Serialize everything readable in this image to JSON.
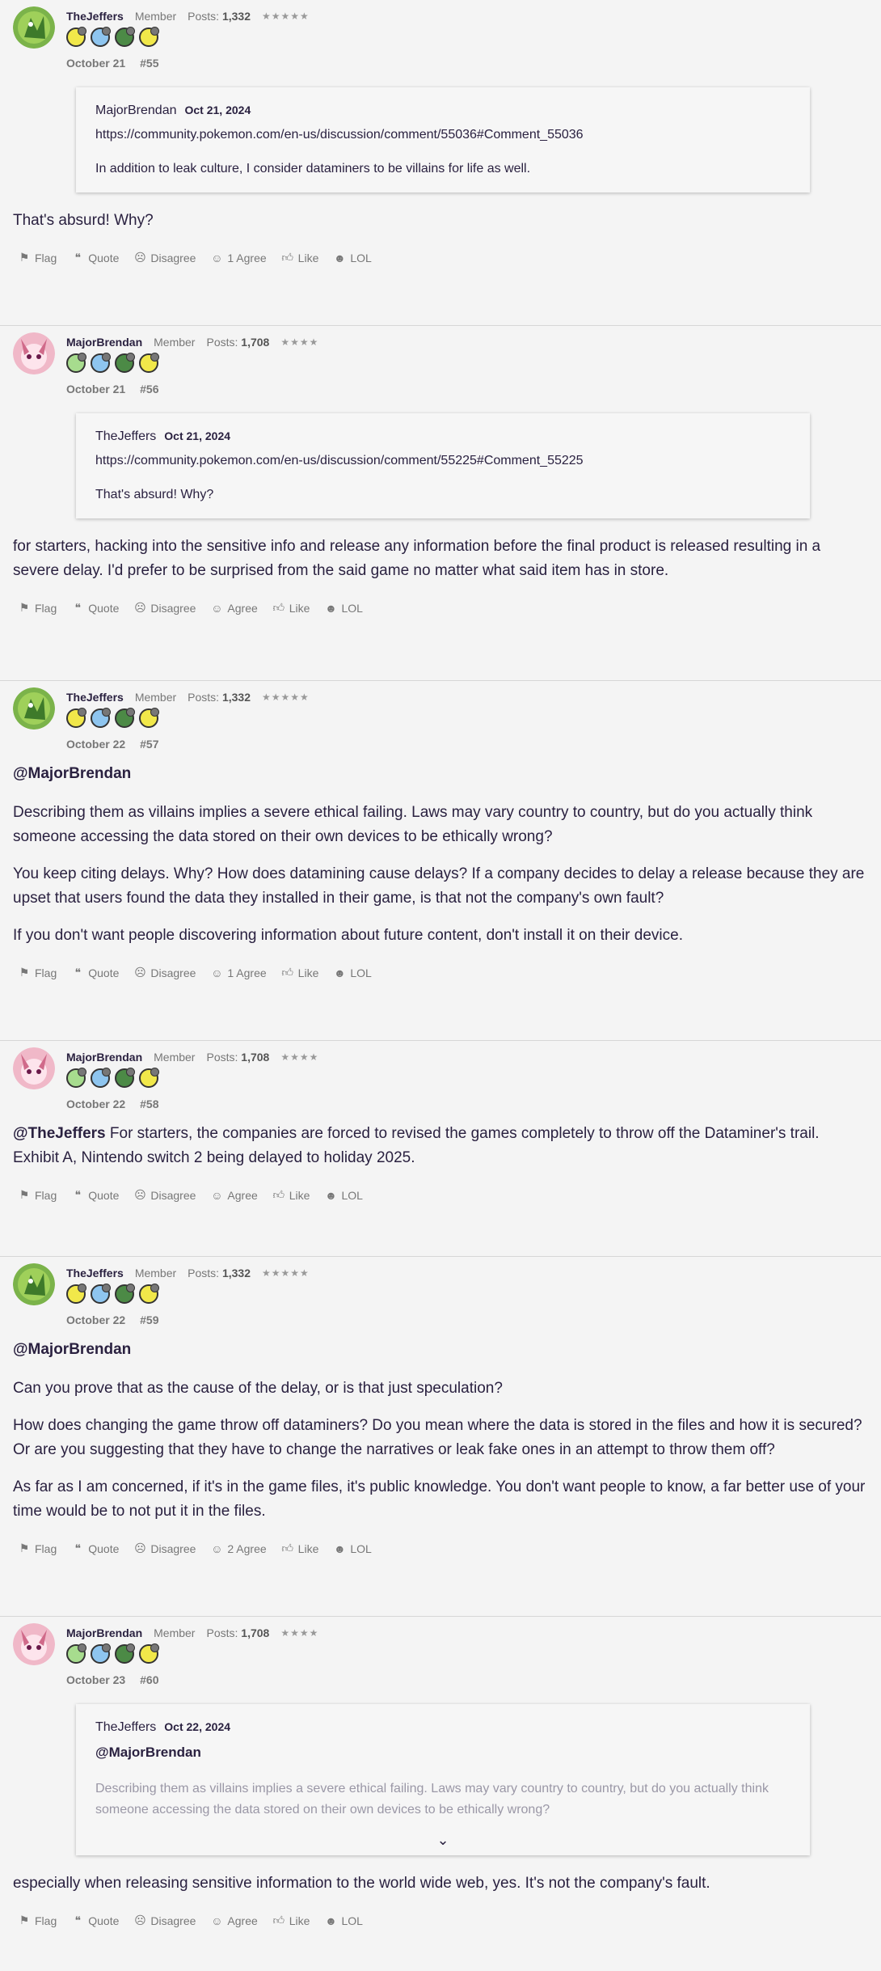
{
  "posts": [
    {
      "author": "TheJeffers",
      "role": "Member",
      "posts_label": "Posts:",
      "posts_count": "1,332",
      "stars": "★★★★★",
      "date": "October 21",
      "number": "#55",
      "quote": {
        "author": "MajorBrendan",
        "date": "Oct 21, 2024",
        "link": "https://community.pokemon.com/en-us/discussion/comment/55036#Comment_55036",
        "text": "In addition to leak culture, I consider dataminers to be villains for life as well."
      },
      "paragraphs": [
        "That's absurd! Why?"
      ],
      "actions": {
        "flag": "Flag",
        "quote": "Quote",
        "disagree": "Disagree",
        "agree": "1 Agree",
        "like": "Like",
        "lol": "LOL"
      }
    },
    {
      "author": "MajorBrendan",
      "role": "Member",
      "posts_label": "Posts:",
      "posts_count": "1,708",
      "stars": "★★★★",
      "date": "October 21",
      "number": "#56",
      "quote": {
        "author": "TheJeffers",
        "date": "Oct 21, 2024",
        "link": "https://community.pokemon.com/en-us/discussion/comment/55225#Comment_55225",
        "text": "That's absurd! Why?"
      },
      "paragraphs": [
        "for starters, hacking into the sensitive info and release any information before the final product is released resulting in a severe delay. I'd prefer to be surprised from the said game no matter what said item has in store."
      ],
      "actions": {
        "flag": "Flag",
        "quote": "Quote",
        "disagree": "Disagree",
        "agree": "Agree",
        "like": "Like",
        "lol": "LOL"
      }
    },
    {
      "author": "TheJeffers",
      "role": "Member",
      "posts_label": "Posts:",
      "posts_count": "1,332",
      "stars": "★★★★★",
      "date": "October 22",
      "number": "#57",
      "mention": "@MajorBrendan",
      "paragraphs": [
        "Describing them as villains implies a severe ethical failing. Laws may vary country to country, but do you actually think someone accessing the data stored on their own devices to be ethically wrong?",
        "You keep citing delays. Why? How does datamining cause delays? If a company decides to delay a release because they are upset that users found the data they installed in their game, is that not the company's own fault?",
        "If you don't want people discovering information about future content, don't install it on their device."
      ],
      "actions": {
        "flag": "Flag",
        "quote": "Quote",
        "disagree": "Disagree",
        "agree": "1 Agree",
        "like": "Like",
        "lol": "LOL"
      }
    },
    {
      "author": "MajorBrendan",
      "role": "Member",
      "posts_label": "Posts:",
      "posts_count": "1,708",
      "stars": "★★★★",
      "date": "October 22",
      "number": "#58",
      "inline_mention": "@TheJeffers",
      "inline_text": " For starters, the companies are forced to revised the games completely to throw off the Dataminer's trail. Exhibit A, Nintendo switch 2 being delayed to holiday 2025.",
      "actions": {
        "flag": "Flag",
        "quote": "Quote",
        "disagree": "Disagree",
        "agree": "Agree",
        "like": "Like",
        "lol": "LOL"
      }
    },
    {
      "author": "TheJeffers",
      "role": "Member",
      "posts_label": "Posts:",
      "posts_count": "1,332",
      "stars": "★★★★★",
      "date": "October 22",
      "number": "#59",
      "mention": "@MajorBrendan",
      "paragraphs": [
        "Can you prove that as the cause of the delay, or is that just speculation?",
        "How does changing the game throw off dataminers? Do you mean where the data is stored in the files and how it is secured? Or are you suggesting that they have to change the narratives or leak fake ones in an attempt to throw them off?",
        "As far as I am concerned, if it's in the game files, it's public knowledge. You don't want people to know, a far better use of your time would be to not put it in the files."
      ],
      "actions": {
        "flag": "Flag",
        "quote": "Quote",
        "disagree": "Disagree",
        "agree": "2 Agree",
        "like": "Like",
        "lol": "LOL"
      }
    },
    {
      "author": "MajorBrendan",
      "role": "Member",
      "posts_label": "Posts:",
      "posts_count": "1,708",
      "stars": "★★★★",
      "date": "October 23",
      "number": "#60",
      "quote": {
        "author": "TheJeffers",
        "date": "Oct 22, 2024",
        "mention": "@MajorBrendan",
        "text": "Describing them as villains implies a severe ethical failing. Laws may vary country to country, but do you actually think someone accessing the data stored on their own devices to be ethically wrong?"
      },
      "paragraphs": [
        "especially when releasing sensitive information to the world wide web, yes. It's not the company's fault."
      ],
      "actions": {
        "flag": "Flag",
        "quote": "Quote",
        "disagree": "Disagree",
        "agree": "Agree",
        "like": "Like",
        "lol": "LOL"
      }
    }
  ]
}
